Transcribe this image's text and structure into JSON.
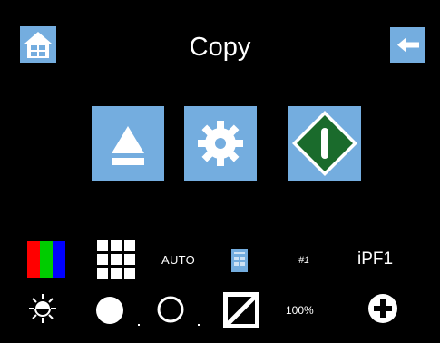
{
  "header": {
    "title": "Copy",
    "home_icon": "home-icon",
    "back_icon": "back-arrow-icon"
  },
  "actions": [
    {
      "name": "eject",
      "icon": "eject-icon"
    },
    {
      "name": "settings",
      "icon": "gear-icon"
    },
    {
      "name": "start",
      "icon": "start-diamond-icon"
    }
  ],
  "status": {
    "mode_label": "AUTO",
    "tray_label": "#1",
    "paper_source": "iPF1",
    "zoom": "100%"
  },
  "colors": {
    "background": "#000000",
    "tile": "#74addf",
    "start_green": "#1a6b2c",
    "icon_white": "#ffffff",
    "rgb_red": "#ff0000",
    "rgb_green": "#00cc00",
    "rgb_blue": "#0000ff"
  }
}
